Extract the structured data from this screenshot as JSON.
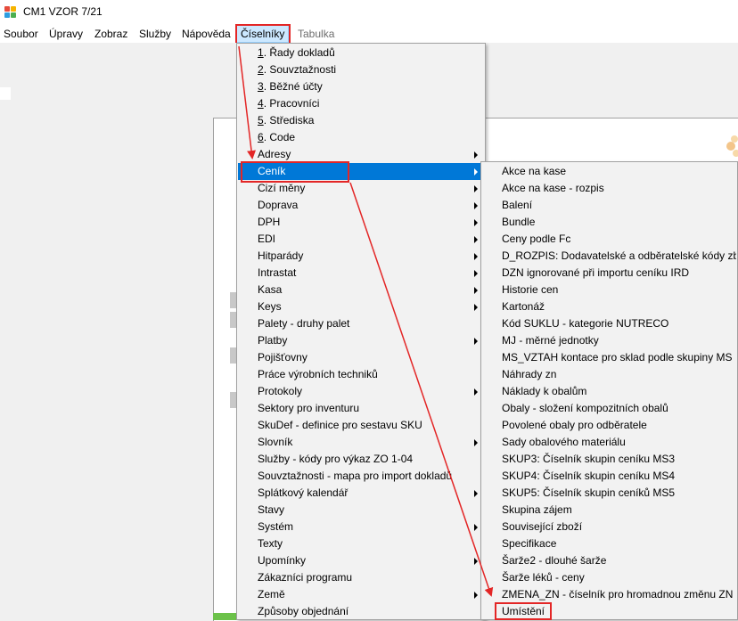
{
  "window": {
    "title": "CM1 VZOR 7/21"
  },
  "menubar": [
    {
      "label": "Soubor"
    },
    {
      "label": "Úpravy"
    },
    {
      "label": "Zobraz"
    },
    {
      "label": "Služby"
    },
    {
      "label": "Nápověda"
    },
    {
      "label": "Číselníky",
      "state": "active"
    },
    {
      "label": "Tabulka",
      "state": "disabled"
    }
  ],
  "ciselniky_menu": [
    {
      "num": "1",
      "label": ". Řady dokladů"
    },
    {
      "num": "2",
      "label": ". Souvztažnosti"
    },
    {
      "num": "3",
      "label": ". Běžné účty"
    },
    {
      "num": "4",
      "label": ". Pracovníci"
    },
    {
      "num": "5",
      "label": ". Střediska"
    },
    {
      "num": "6",
      "label": ". Code"
    },
    {
      "label": "Adresy",
      "submenu": true
    },
    {
      "label": "Ceník",
      "submenu": true,
      "highlighted": true
    },
    {
      "label": "Cizí měny",
      "submenu": true
    },
    {
      "label": "Doprava",
      "submenu": true
    },
    {
      "label": "DPH",
      "submenu": true
    },
    {
      "label": "EDI",
      "submenu": true
    },
    {
      "label": "Hitparády",
      "submenu": true
    },
    {
      "label": "Intrastat",
      "submenu": true
    },
    {
      "label": "Kasa",
      "submenu": true
    },
    {
      "label": "Keys",
      "submenu": true
    },
    {
      "label": "Palety - druhy palet"
    },
    {
      "label": "Platby",
      "submenu": true
    },
    {
      "label": "Pojišťovny"
    },
    {
      "label": "Práce výrobních techniků"
    },
    {
      "label": "Protokoly",
      "submenu": true
    },
    {
      "label": "Sektory pro inventuru"
    },
    {
      "label": "SkuDef - definice pro sestavu SKU"
    },
    {
      "label": "Slovník",
      "submenu": true
    },
    {
      "label": "Služby - kódy pro výkaz ZO 1-04"
    },
    {
      "label": "Souvztažnosti - mapa pro import dokladů"
    },
    {
      "label": "Splátkový kalendář",
      "submenu": true
    },
    {
      "label": "Stavy"
    },
    {
      "label": "Systém",
      "submenu": true
    },
    {
      "label": "Texty"
    },
    {
      "label": "Upomínky",
      "submenu": true
    },
    {
      "label": "Zákazníci programu"
    },
    {
      "label": "Země",
      "submenu": true
    },
    {
      "label": "Způsoby objednání"
    }
  ],
  "cenik_menu": [
    {
      "label": "Akce na kase"
    },
    {
      "label": "Akce na kase - rozpis"
    },
    {
      "label": "Balení"
    },
    {
      "label": "Bundle"
    },
    {
      "label": "Ceny podle Fc"
    },
    {
      "label": "D_ROZPIS: Dodavatelské a odběratelské kódy zboží"
    },
    {
      "label": "DZN ignorované při importu ceníku IRD"
    },
    {
      "label": "Historie cen"
    },
    {
      "label": "Kartonáž"
    },
    {
      "label": "Kód SUKLU - kategorie NUTRECO"
    },
    {
      "label": "MJ - měrné jednotky"
    },
    {
      "label": "MS_VZTAH kontace pro sklad podle skupiny MS"
    },
    {
      "label": "Náhrady zn"
    },
    {
      "label": "Náklady k obalům"
    },
    {
      "label": "Obaly - složení kompozitních obalů"
    },
    {
      "label": "Povolené obaly pro odběratele"
    },
    {
      "label": "Sady obalového materiálu"
    },
    {
      "label": "SKUP3: Číselník skupin ceníku MS3"
    },
    {
      "label": "SKUP4: Číselník skupin ceníku MS4"
    },
    {
      "label": "SKUP5: Číselník skupin ceníků MS5"
    },
    {
      "label": "Skupina zájem"
    },
    {
      "label": "Související zboží"
    },
    {
      "label": "Specifikace"
    },
    {
      "label": "Šarže2 - dlouhé šarže"
    },
    {
      "label": "Šarže léků - ceny"
    },
    {
      "label": "ZMENA_ZN - číselník pro hromadnou změnu ZN"
    },
    {
      "label": "Umístění"
    }
  ],
  "colors": {
    "highlight": "#0078d7",
    "annotation": "#e32626",
    "menu_active_bg": "#cce8ff"
  }
}
